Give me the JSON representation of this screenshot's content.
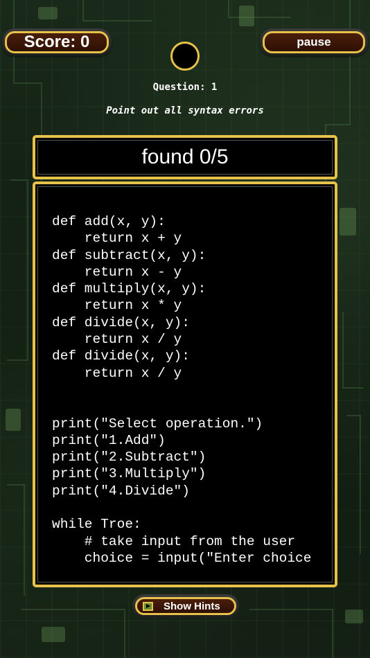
{
  "header": {
    "score_label": "Score: 0",
    "pause_label": "pause"
  },
  "question": {
    "label": "Question: 1",
    "instruction": "Point out all syntax errors",
    "found_text": "found 0/5"
  },
  "code": {
    "lines": [
      "def add(x, y):",
      "    return x + y",
      "def subtract(x, y):",
      "    return x - y",
      "def multiply(x, y):",
      "    return x * y",
      "def divide(x, y):",
      "    return x / y",
      "def divide(x, y):",
      "    return x / y",
      "",
      "",
      "print(\"Select operation.\")",
      "print(\"1.Add\")",
      "print(\"2.Subtract\")",
      "print(\"3.Multiply\")",
      "print(\"4.Divide\")",
      "",
      "while Troe:",
      "    # take input from the user",
      "    choice = input(\"Enter choice"
    ]
  },
  "footer": {
    "hints_label": "Show Hints"
  },
  "colors": {
    "accent_gold": "#e6c24a",
    "button_brown": "#3a1608",
    "panel_black": "#000000"
  }
}
